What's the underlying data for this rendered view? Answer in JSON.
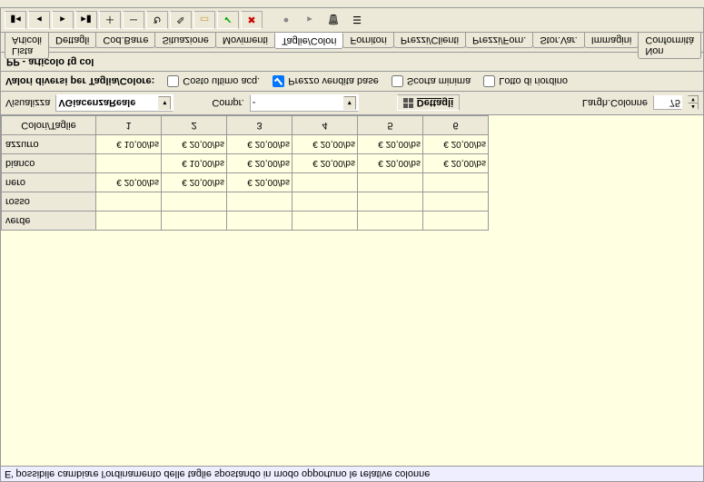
{
  "hint": "E' possibile cambiare l'ordinamento delle taglie spostando in modo opportuno le relative colonne",
  "grid": {
    "corner": "Colori/Taglie",
    "cols": [
      "1",
      "2",
      "3",
      "4",
      "5",
      "6"
    ],
    "rows": [
      {
        "label": "verde",
        "cells": [
          "",
          "",
          "",
          "",
          "",
          ""
        ]
      },
      {
        "label": "rosso",
        "cells": [
          "",
          "",
          "",
          "",
          "",
          ""
        ]
      },
      {
        "label": "nero",
        "cells": [
          "€ 20,00/bs",
          "€ 20,00/bs",
          "€ 20,00/bs",
          "",
          "",
          ""
        ]
      },
      {
        "label": "bianco",
        "cells": [
          "",
          "€ 10,00/bs",
          "€ 20,00/bs",
          "€ 20,00/bs",
          "€ 20,00/bs",
          "€ 20,00/bs"
        ]
      },
      {
        "label": "azzurro",
        "cells": [
          "€ 10,00/bs",
          "€ 20,00/bs",
          "€ 20,00/bs",
          "€ 20,00/bs",
          "€ 20,00/bs",
          "€ 20,00/bs"
        ]
      }
    ]
  },
  "options": {
    "visualizza_label": "Visualizza",
    "visualizza_value": "VGiacenzaReale",
    "compr_label": "Compr.",
    "compr_value": "-",
    "dettagli_btn": "Dettagli",
    "largh_label": "Largh.Colonne",
    "largh_value": "75"
  },
  "checks": {
    "title": "Valori diversi per Taglia/Colore:",
    "costo": "Costo ultimo acq.",
    "prezzo": "Prezzo vendita base",
    "scorta": "Scorta minima",
    "lotto": "Lotto di riordino"
  },
  "article_title": "PP  -  articolo tg col",
  "tabs": [
    "Lista Articoli",
    "Dettagli",
    "Cod.Barre",
    "Situazione",
    "Movimenti",
    "Taglie/Colori",
    "Fornitori",
    "Prezzi/Clienti",
    "Prezzi/Forn.",
    "Stor.Var.",
    "Immagini",
    "Non Conformità"
  ],
  "active_tab_index": 5,
  "chart_data": {
    "type": "table",
    "title": "Colori/Taglie — Prezzo vendita base",
    "xlabel": "Taglia",
    "ylabel": "Colore",
    "categories": [
      "1",
      "2",
      "3",
      "4",
      "5",
      "6"
    ],
    "series": [
      {
        "name": "verde",
        "values": [
          null,
          null,
          null,
          null,
          null,
          null
        ]
      },
      {
        "name": "rosso",
        "values": [
          null,
          null,
          null,
          null,
          null,
          null
        ]
      },
      {
        "name": "nero",
        "values": [
          20.0,
          20.0,
          20.0,
          null,
          null,
          null
        ]
      },
      {
        "name": "bianco",
        "values": [
          null,
          10.0,
          20.0,
          20.0,
          20.0,
          20.0
        ]
      },
      {
        "name": "azzurro",
        "values": [
          10.0,
          20.0,
          20.0,
          20.0,
          20.0,
          20.0
        ]
      }
    ],
    "unit": "€/bs"
  }
}
